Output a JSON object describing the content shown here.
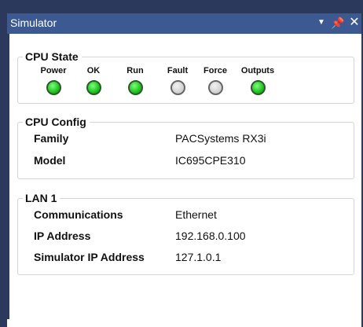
{
  "window": {
    "title": "Simulator",
    "menu_icon": "dropdown-arrow-icon",
    "pin_icon": "pin-icon",
    "close_icon": "close-icon"
  },
  "cpu_state": {
    "title": "CPU State",
    "leds": [
      {
        "label": "Power",
        "state": "on",
        "color": "#1fc21f"
      },
      {
        "label": "OK",
        "state": "on",
        "color": "#1fc21f"
      },
      {
        "label": "Run",
        "state": "on",
        "color": "#1fc21f"
      },
      {
        "label": "Fault",
        "state": "off",
        "color": "#cfcfcf"
      },
      {
        "label": "Force",
        "state": "off",
        "color": "#cfcfcf"
      },
      {
        "label": "Outputs",
        "state": "on",
        "color": "#1fc21f"
      }
    ]
  },
  "cpu_config": {
    "title": "CPU Config",
    "rows": [
      {
        "key": "Family",
        "value": "PACSystems RX3i"
      },
      {
        "key": "Model",
        "value": "IC695CPE310"
      }
    ]
  },
  "lan": {
    "title": "LAN 1",
    "rows": [
      {
        "key": "Communications",
        "value": "Ethernet"
      },
      {
        "key": "IP Address",
        "value": "192.168.0.100"
      },
      {
        "key": "Simulator IP Address",
        "value": "127.1.0.1"
      }
    ]
  },
  "colors": {
    "titlebar": "#3c5a91",
    "frame": "#2b3a5c",
    "led_on": "#1fc21f",
    "led_off": "#cfcfcf"
  }
}
